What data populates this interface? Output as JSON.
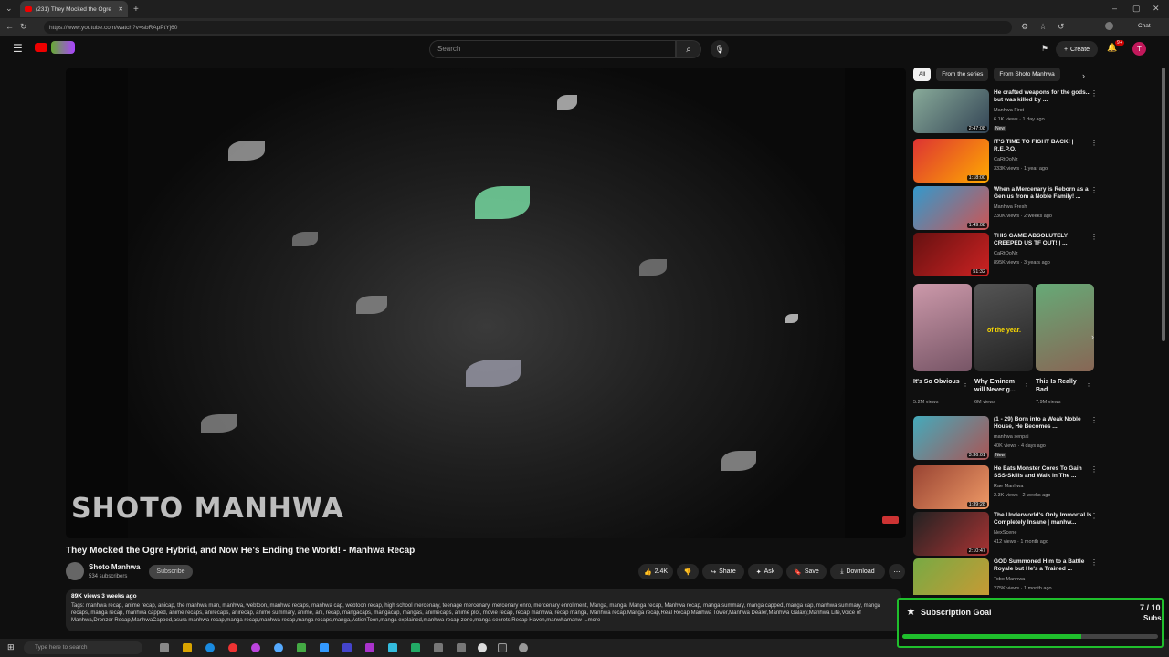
{
  "browser": {
    "tab_title": "(231) They Mocked the Ogre",
    "url": "https://www.youtube.com/watch?v=sbRApPtYj60",
    "chat_label": "Chat"
  },
  "header": {
    "search_placeholder": "Search",
    "create_label": "Create",
    "notif_count": "9+",
    "avatar_letter": "T"
  },
  "video": {
    "watermark": "SHOTO MANHWA",
    "title": "They Mocked the Ogre Hybrid, and Now He's Ending the World! - Manhwa Recap",
    "channel": "Shoto Manhwa",
    "subscribers": "534 subscribers",
    "subscribe_label": "Subscribe",
    "likes": "2.4K",
    "share": "Share",
    "ask": "Ask",
    "save": "Save",
    "download": "Download",
    "views_date": "89K views  3 weeks ago",
    "tags": "Tags: manhwa recap, anime recap, anicap, the manhwa man, manhwa, webtoon, manhwa recaps, manhwa cap, webtoon recap, high school mercenary, teenage mercenary, mercenary enro, mercenary enrollment, Manga, manga, Manga recap, Manhwa recap, manga summary, manga capped, manga cap, manhwa summary, manga recaps, manga recap, manhwa capped, anime recaps, anirecaps, anirecap, anime summary, anime, ani, recap, mangacaps, mangacap, mangas, animecaps, anime plot, movie recap, recap manhwa, recap manga, Manhwa recap,Manga recap,Real Recap,Manhwa Tower,Manhwa Dealer,Manhwa Galaxy,Manhwa Life,Voice of Manhwa,Dronzer Recap,ManhwaCapped,asura manhwa recap,manga recap,manhwa recap,manga recaps,manga,ActionToon,manga explained,manhwa recap zone,manga secrets,Recap Haven,manwhamanw  ...more"
  },
  "chips": [
    "All",
    "From the series",
    "From Shoto Manhwa"
  ],
  "recommendations": [
    {
      "title": "He crafted weapons for the gods... but was killed by ...",
      "channel": "Manhwa First",
      "meta": "6.1K views · 1 day ago",
      "badge": "New",
      "duration": "2:47:08"
    },
    {
      "title": "IT'S TIME TO FIGHT BACK! | R.E.P.O.",
      "channel": "CaRtOoNz",
      "meta": "333K views · 1 year ago",
      "badge": "",
      "duration": "1:18:00"
    },
    {
      "title": "When a Mercenary is Reborn as a Genius from a Noble Family! ...",
      "channel": "Manhwa Fresh",
      "meta": "230K views · 2 weeks ago",
      "badge": "",
      "duration": "1:49:08"
    },
    {
      "title": "THIS GAME ABSOLUTELY CREEPED US TF OUT! | ...",
      "channel": "CaRtOoNz",
      "meta": "895K views · 3 years ago",
      "badge": "",
      "duration": "51:32"
    }
  ],
  "shorts": [
    {
      "title": "It's So Obvious",
      "views": "5.2M views"
    },
    {
      "title": "Why Eminem will Never g...",
      "views": "6M views"
    },
    {
      "title": "This Is Really Bad",
      "views": "7.9M views"
    }
  ],
  "shorts_caption": "of the year.",
  "recommendations2": [
    {
      "title": "(1 - 29) Born into a Weak Noble House, He Becomes ...",
      "channel": "manhwa senpai",
      "meta": "40K views · 4 days ago",
      "badge": "New",
      "duration": "3:36:01"
    },
    {
      "title": "He Eats Monster Cores To Gain SSS-Skills and Walk in The ...",
      "channel": "Rae Manhwa",
      "meta": "2.3K views · 2 weeks ago",
      "badge": "",
      "duration": "1:39:28"
    },
    {
      "title": "The Underworld's Only Immortal Is Completely Insane | manhw...",
      "channel": "NexScene",
      "meta": "412 views · 1 month ago",
      "badge": "",
      "duration": "2:10:47"
    },
    {
      "title": "GOD Summoned Him to a Battle Royale but He's a Trained ...",
      "channel": "Tobo Manhwa",
      "meta": "275K views · 1 month ago",
      "badge": "",
      "duration": ""
    }
  ],
  "taskbar": {
    "search_placeholder": "Type here to search"
  },
  "goal": {
    "title": "Subscription Goal",
    "count": "7 / 10",
    "unit": "Subs",
    "progress": 0.7
  }
}
